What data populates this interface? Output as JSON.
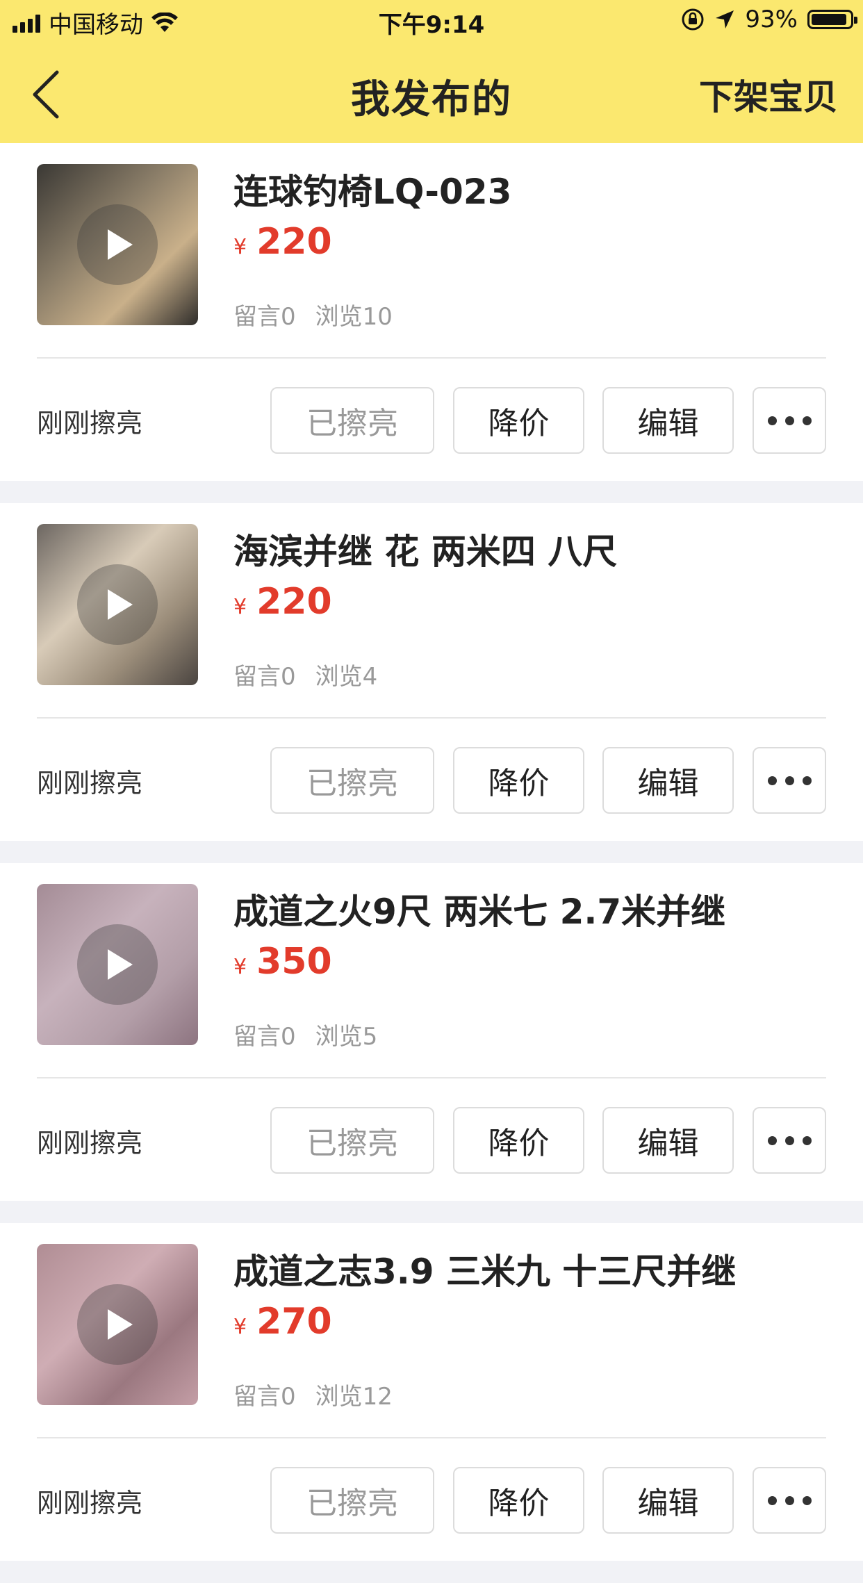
{
  "status_bar": {
    "carrier": "中国移动",
    "time": "下午9:14",
    "battery": "93%",
    "battery_level": 0.93
  },
  "nav": {
    "title": "我发布的",
    "action": "下架宝贝",
    "back_icon": "chevron-left-icon"
  },
  "colors": {
    "header_bg": "#fbe86f",
    "price": "#e23b2b",
    "page_bg": "#f1f2f6"
  },
  "items": [
    {
      "title": "连球钓椅LQ-023",
      "currency": "¥",
      "price": "220",
      "comments": "留言0",
      "views": "浏览10",
      "refresh_text": "刚刚擦亮",
      "btn_refreshed": "已擦亮",
      "btn_reduce": "降价",
      "btn_edit": "编辑",
      "thumb_colors": [
        "#3a3834",
        "#8a7d68",
        "#c9b08a",
        "#2e2c2a"
      ]
    },
    {
      "title": "海滨并继 花 两米四 八尺",
      "currency": "¥",
      "price": "220",
      "comments": "留言0",
      "views": "浏览4",
      "refresh_text": "刚刚擦亮",
      "btn_refreshed": "已擦亮",
      "btn_reduce": "降价",
      "btn_edit": "编辑",
      "thumb_colors": [
        "#6c6661",
        "#d8cbb8",
        "#9b8d7a",
        "#4a4440"
      ]
    },
    {
      "title": "成道之火9尺 两米七 2.7米并继",
      "currency": "¥",
      "price": "350",
      "comments": "留言0",
      "views": "浏览5",
      "refresh_text": "刚刚擦亮",
      "btn_refreshed": "已擦亮",
      "btn_reduce": "降价",
      "btn_edit": "编辑",
      "thumb_colors": [
        "#a48c96",
        "#c7b2bc",
        "#b39ea8",
        "#8d7480"
      ]
    },
    {
      "title": "成道之志3.9 三米九 十三尺并继",
      "currency": "¥",
      "price": "270",
      "comments": "留言0",
      "views": "浏览12",
      "refresh_text": "刚刚擦亮",
      "btn_refreshed": "已擦亮",
      "btn_reduce": "降价",
      "btn_edit": "编辑",
      "thumb_colors": [
        "#b08d94",
        "#cfadb4",
        "#9b7880",
        "#c49ea6"
      ]
    }
  ]
}
